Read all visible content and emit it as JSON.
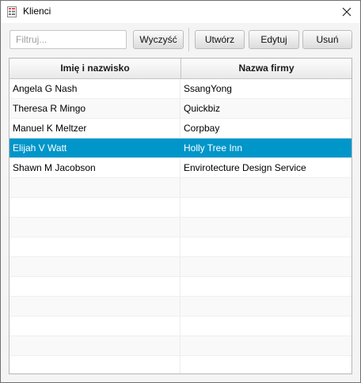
{
  "window": {
    "title": "Klienci",
    "close_glyph": "×"
  },
  "toolbar": {
    "filter_placeholder": "Filtruj...",
    "filter_value": "",
    "clear_label": "Wyczyść",
    "create_label": "Utwórz",
    "edit_label": "Edytuj",
    "delete_label": "Usuń"
  },
  "table": {
    "columns": [
      "Imię i nazwisko",
      "Nazwa firmy"
    ],
    "selected_index": 3,
    "selection_color": "#0096c9",
    "rows": [
      {
        "name": "Angela G Nash",
        "company": "SsangYong"
      },
      {
        "name": "Theresa R Mingo",
        "company": "Quickbiz"
      },
      {
        "name": "Manuel K Meltzer",
        "company": "Corpbay"
      },
      {
        "name": "Elijah V Watt",
        "company": "Holly Tree Inn"
      },
      {
        "name": "Shawn M Jacobson",
        "company": "Envirotecture Design Service"
      },
      {
        "name": "",
        "company": ""
      },
      {
        "name": "",
        "company": ""
      },
      {
        "name": "",
        "company": ""
      },
      {
        "name": "",
        "company": ""
      },
      {
        "name": "",
        "company": ""
      },
      {
        "name": "",
        "company": ""
      },
      {
        "name": "",
        "company": ""
      },
      {
        "name": "",
        "company": ""
      },
      {
        "name": "",
        "company": ""
      },
      {
        "name": "",
        "company": ""
      },
      {
        "name": "",
        "company": ""
      }
    ]
  },
  "icons": {
    "app": "clients-app-icon",
    "close": "close-icon"
  }
}
